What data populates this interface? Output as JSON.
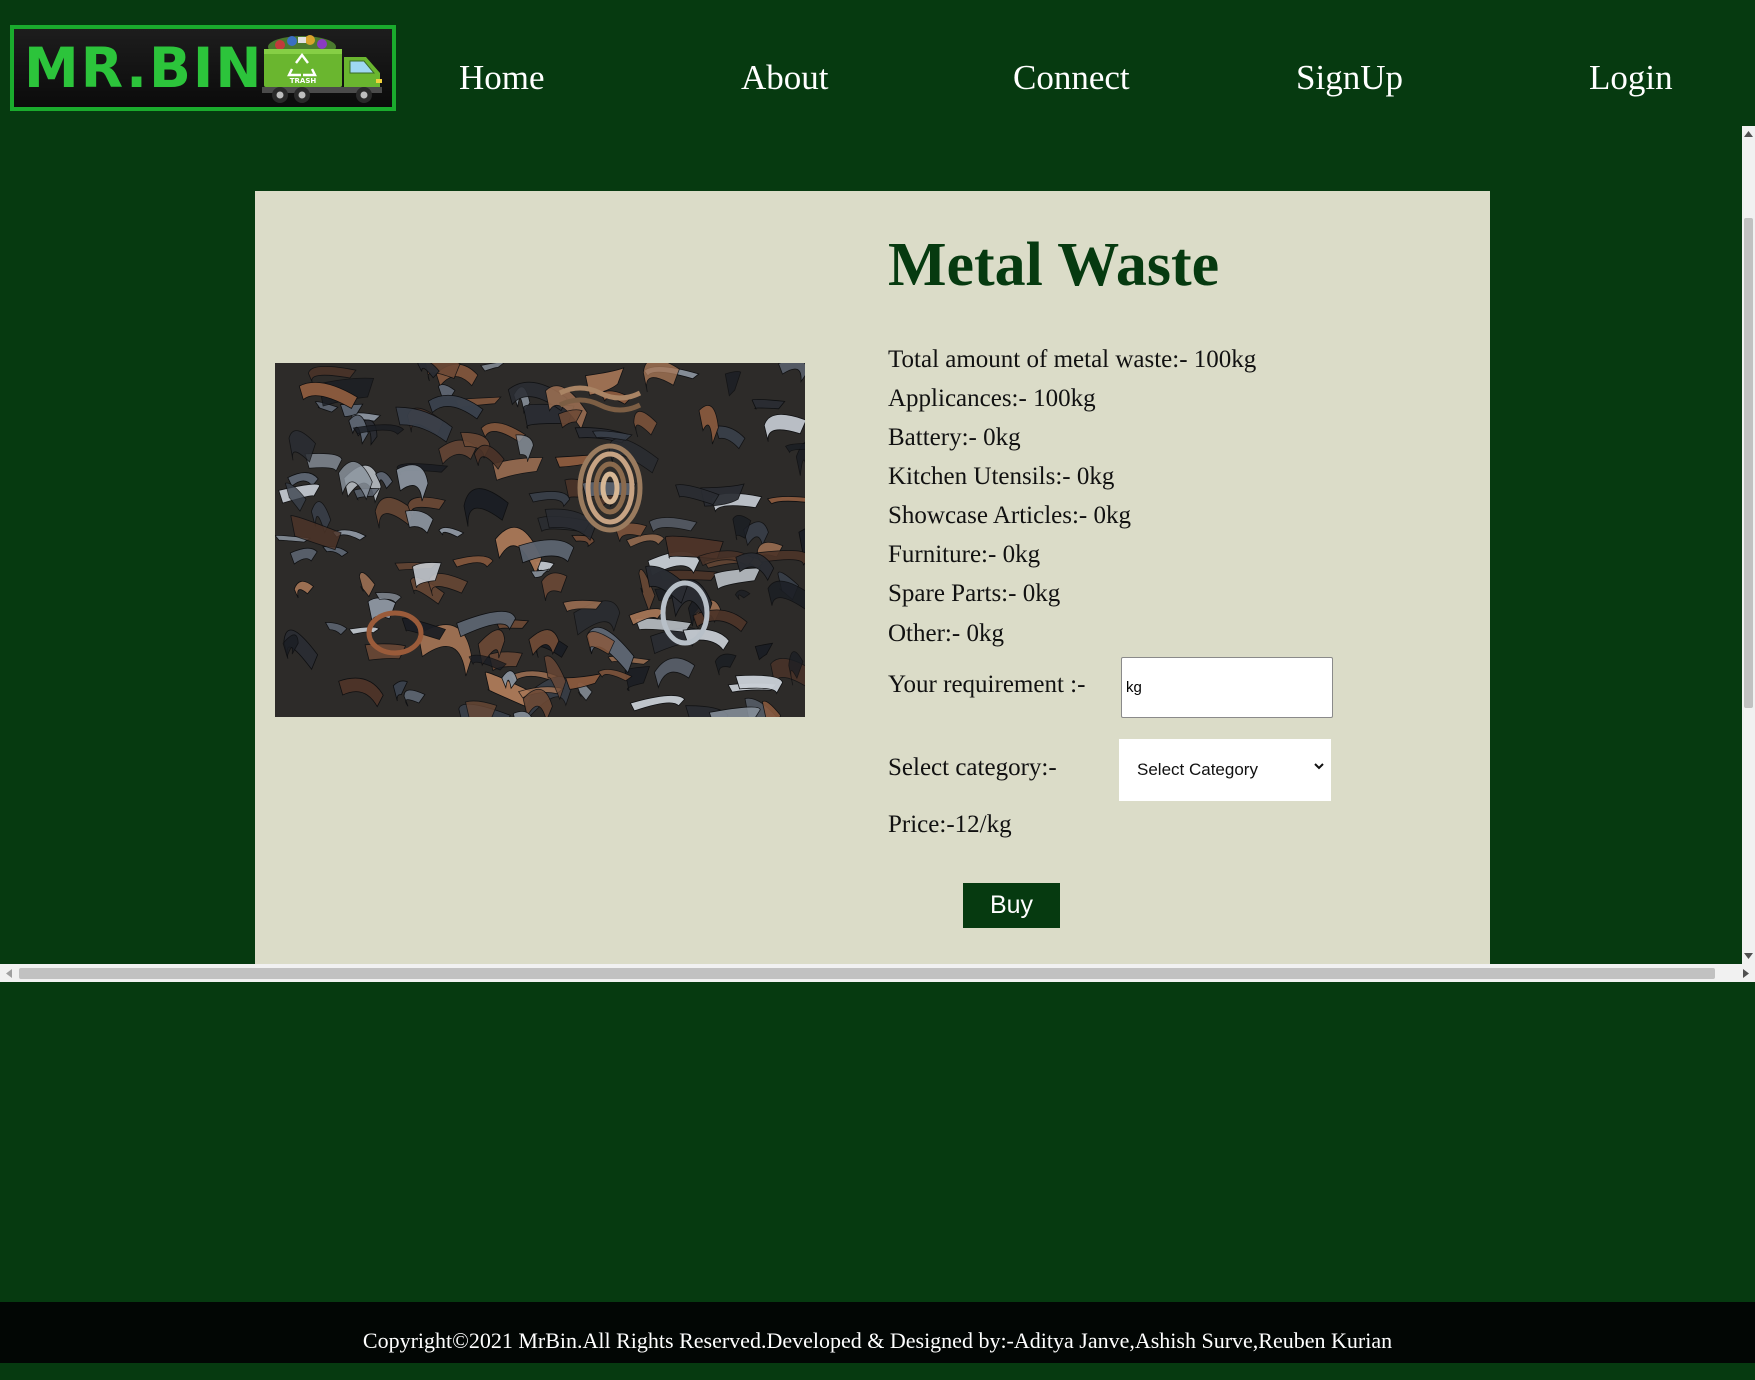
{
  "brand": {
    "logo_text": "MR.BIN",
    "truck_label": "TRASH"
  },
  "nav": {
    "home": "Home",
    "about": "About",
    "connect": "Connect",
    "signup": "SignUp",
    "login": "Login"
  },
  "product": {
    "title": "Metal Waste",
    "details": [
      "Total amount of metal waste:- 100kg",
      "Applicances:- 100kg",
      "Battery:- 0kg",
      "Kitchen Utensils:- 0kg",
      "Showcase Articles:- 0kg",
      "Furniture:- 0kg",
      "Spare Parts:- 0kg",
      "Other:- 0kg"
    ],
    "requirement_label": "Your requirement :-",
    "requirement_placeholder": "kg",
    "category_label": "Select category:-",
    "category_selected": "Select Category",
    "price": "Price:-12/kg",
    "buy_label": "Buy"
  },
  "footer": {
    "text": "Copyright©2021 MrBin.All Rights Reserved.Developed & Designed by:-Aditya Janve,Ashish Surve,Reuben Kurian"
  },
  "colors": {
    "page_background": "#063a10",
    "card_background": "#dbdcc8",
    "accent_green": "#063a10",
    "logo_green": "#2cc43b",
    "footer_background": "#020604"
  },
  "icons": {
    "logo_truck": "garbage-truck-icon",
    "recycle": "recycle-icon",
    "select_chevron": "chevron-down-icon"
  }
}
